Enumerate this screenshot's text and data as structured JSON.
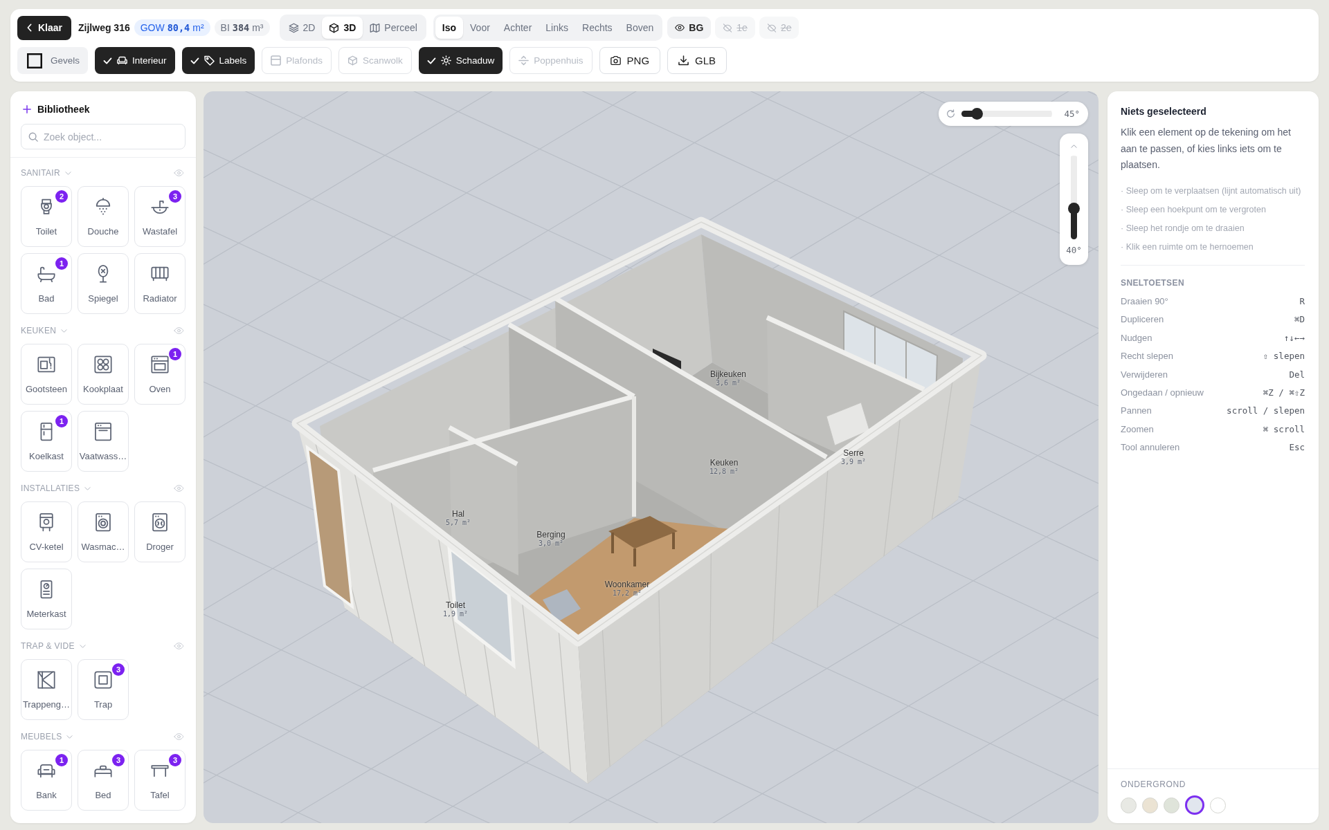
{
  "toolbar": {
    "back_button": {
      "label": "Klaar"
    },
    "project": "Zijlweg 316",
    "stats": [
      {
        "kind": "area",
        "label": "GOW",
        "value": "80,4",
        "unit": "m²"
      },
      {
        "kind": "volume",
        "label": "BI",
        "value": "384",
        "unit": "m³"
      }
    ],
    "view_modes": [
      {
        "label": "2D",
        "selected": false
      },
      {
        "label": "3D",
        "selected": true
      },
      {
        "label": "Perceel",
        "selected": false
      }
    ],
    "camera_views": [
      {
        "label": "Iso",
        "selected": true
      },
      {
        "label": "Voor",
        "selected": false
      },
      {
        "label": "Achter",
        "selected": false
      },
      {
        "label": "Links",
        "selected": false
      },
      {
        "label": "Rechts",
        "selected": false
      },
      {
        "label": "Boven",
        "selected": false
      }
    ],
    "layers": [
      {
        "label": "BG",
        "visible": true
      },
      {
        "label": "1e",
        "visible": false
      },
      {
        "label": "2e",
        "visible": false
      }
    ],
    "toggles": [
      {
        "label": "Gevels",
        "checked": false,
        "disabled": false
      },
      {
        "label": "Interieur",
        "checked": true,
        "disabled": false
      },
      {
        "label": "Labels",
        "checked": true,
        "disabled": false
      },
      {
        "label": "Plafonds",
        "checked": false,
        "disabled": true
      },
      {
        "label": "Scanwolk",
        "checked": false,
        "disabled": true
      },
      {
        "label": "Schaduw",
        "checked": true,
        "disabled": false
      },
      {
        "label": "Poppenhuis",
        "checked": false,
        "disabled": true
      }
    ],
    "exports": [
      {
        "label": "PNG"
      },
      {
        "label": "GLB"
      }
    ]
  },
  "library": {
    "title": "Bibliotheek",
    "search": {
      "placeholder": "Zoek object..."
    },
    "categories": [
      {
        "name": "SANITAIR",
        "expanded": true,
        "visible": true,
        "items": [
          {
            "label": "Toilet",
            "count": "2"
          },
          {
            "label": "Douche"
          },
          {
            "label": "Wastafel",
            "count": "3"
          },
          {
            "label": "Bad",
            "count": "1"
          },
          {
            "label": "Spiegel"
          },
          {
            "label": "Radiator"
          }
        ]
      },
      {
        "name": "KEUKEN",
        "expanded": true,
        "visible": true,
        "items": [
          {
            "label": "Gootsteen"
          },
          {
            "label": "Kookplaat"
          },
          {
            "label": "Oven",
            "count": "1"
          },
          {
            "label": "Koelkast",
            "count": "1"
          },
          {
            "label": "Vaatwass…"
          }
        ]
      },
      {
        "name": "INSTALLATIES",
        "expanded": true,
        "visible": true,
        "items": [
          {
            "label": "CV-ketel"
          },
          {
            "label": "Wasmac…"
          },
          {
            "label": "Droger"
          },
          {
            "label": "Meterkast"
          }
        ]
      },
      {
        "name": "TRAP & VIDE",
        "expanded": true,
        "visible": true,
        "items": [
          {
            "label": "Trappeng…"
          },
          {
            "label": "Trap",
            "count": "3"
          }
        ]
      },
      {
        "name": "MEUBELS",
        "expanded": true,
        "visible": true,
        "items": [
          {
            "label": "Bank",
            "count": "1"
          },
          {
            "label": "Bed",
            "count": "3"
          },
          {
            "label": "Tafel",
            "count": "3"
          }
        ]
      }
    ]
  },
  "viewport": {
    "rotation": {
      "level": 0.17,
      "reading": "45°"
    },
    "tilt": {
      "level": 0.37,
      "reading": "40°"
    },
    "rooms": [
      {
        "name": "Bijkeuken",
        "area": "3,6 m²"
      },
      {
        "name": "Keuken",
        "area": "12,8 m²"
      },
      {
        "name": "Serre",
        "area": "3,9 m²"
      },
      {
        "name": "Hal",
        "area": "5,7 m²"
      },
      {
        "name": "Berging",
        "area": "3,0 m²"
      },
      {
        "name": "Woonkamer",
        "area": "17,2 m²"
      },
      {
        "name": "Toilet",
        "area": "1,9 m²"
      }
    ]
  },
  "inspector": {
    "title": "Niets geselecteerd",
    "description": "Klik een element op de tekening om het aan te passen, of kies links iets om te plaatsen.",
    "tips": [
      "· Sleep om te verplaatsen (lijnt automatisch uit)",
      "· Sleep een hoekpunt om te vergroten",
      "· Sleep het rondje om te draaien",
      "· Klik een ruimte om te hernoemen"
    ],
    "shortcuts_title": "SNELTOETSEN",
    "shortcuts": [
      {
        "action": "Draaien 90°",
        "keys": "R"
      },
      {
        "action": "Dupliceren",
        "keys": "⌘D"
      },
      {
        "action": "Nudgen",
        "keys": "↑↓←→"
      },
      {
        "action": "Recht slepen",
        "keys": "⇧ slepen"
      },
      {
        "action": "Verwijderen",
        "keys": "Del"
      },
      {
        "action": "Ongedaan / opnieuw",
        "keys": "⌘Z / ⌘⇧Z"
      },
      {
        "action": "Pannen",
        "keys": "scroll / slepen"
      },
      {
        "action": "Zoomen",
        "keys": "⌘ scroll"
      },
      {
        "action": "Tool annuleren",
        "keys": "Esc"
      }
    ],
    "ground": {
      "title": "ONDERGROND",
      "swatches": [
        {
          "color": "#e8e9e4",
          "selected": false
        },
        {
          "color": "#ebe3d3",
          "selected": false
        },
        {
          "color": "#dfe4da",
          "selected": false
        },
        {
          "color": "#e1e6ee",
          "selected": true
        },
        {
          "color": "#ffffff",
          "selected": false
        }
      ]
    }
  }
}
